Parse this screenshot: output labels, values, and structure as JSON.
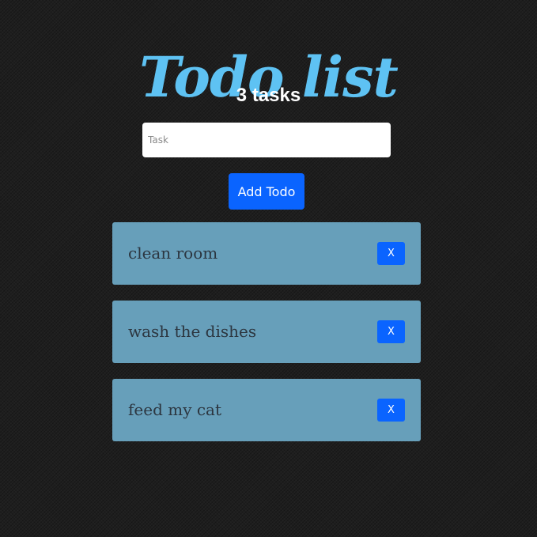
{
  "header": {
    "title": "Todo list",
    "task_count": "3 tasks"
  },
  "form": {
    "input_value": "",
    "input_placeholder": "Task",
    "add_label": "Add Todo"
  },
  "todos": [
    {
      "text": "clean room",
      "delete_label": "X"
    },
    {
      "text": "wash the dishes",
      "delete_label": "X"
    },
    {
      "text": "feed my cat",
      "delete_label": "X"
    }
  ],
  "colors": {
    "title": "#5ec2f3",
    "card": "#679fba",
    "button": "#0a64ff",
    "background": "#1e1e1e"
  }
}
